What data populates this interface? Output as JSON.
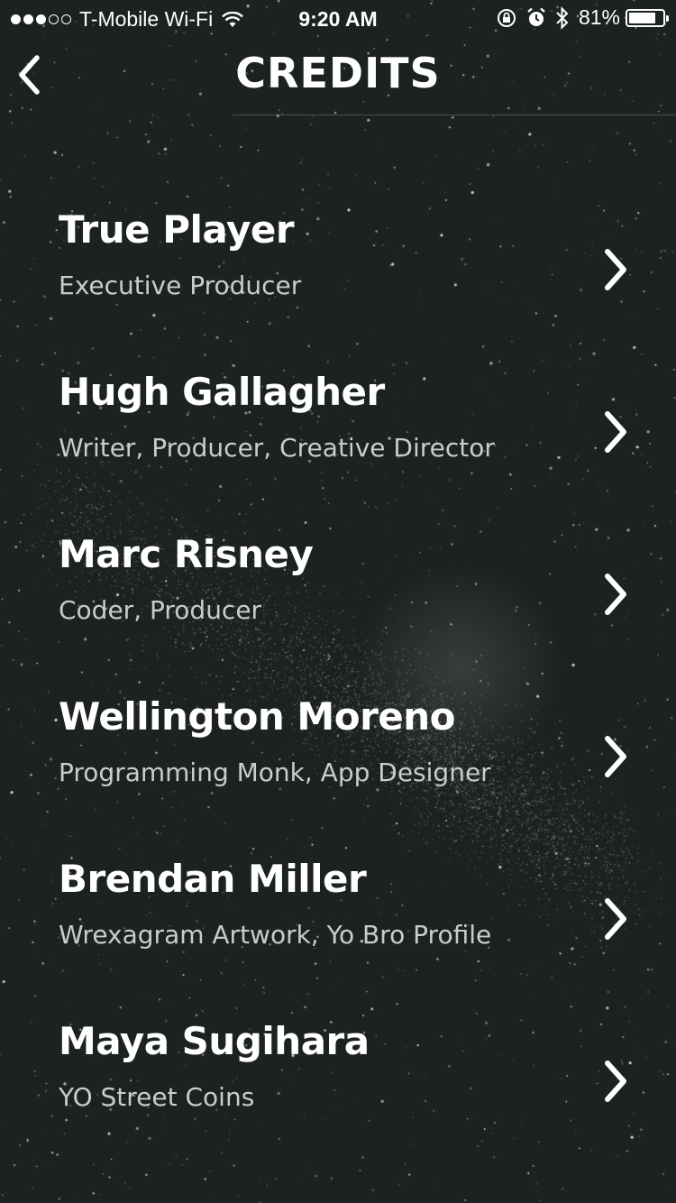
{
  "status_bar": {
    "carrier": "T-Mobile Wi-Fi",
    "time": "9:20 AM",
    "battery_percent": "81%",
    "battery_level": 0.81,
    "signal_bars_filled": 3,
    "signal_bars_total": 5,
    "icons": [
      "wifi-icon",
      "rotation-lock-icon",
      "alarm-icon",
      "bluetooth-icon",
      "battery-icon"
    ]
  },
  "nav": {
    "title": "CREDITS",
    "back_icon": "chevron-left-icon"
  },
  "credits": [
    {
      "name": "True Player",
      "role": "Executive Producer"
    },
    {
      "name": "Hugh Gallagher",
      "role": "Writer, Producer, Creative Director"
    },
    {
      "name": "Marc Risney",
      "role": "Coder, Producer"
    },
    {
      "name": "Wellington Moreno",
      "role": "Programming Monk, App Designer"
    },
    {
      "name": "Brendan Miller",
      "role": "Wrexagram Artwork, Yo Bro Profile"
    },
    {
      "name": "Maya Sugihara",
      "role": "YO Street Coins"
    }
  ],
  "colors": {
    "background": "#1c2122",
    "text": "#ffffff",
    "secondary_text": "#c9cccc",
    "divider": "#4a5152"
  }
}
